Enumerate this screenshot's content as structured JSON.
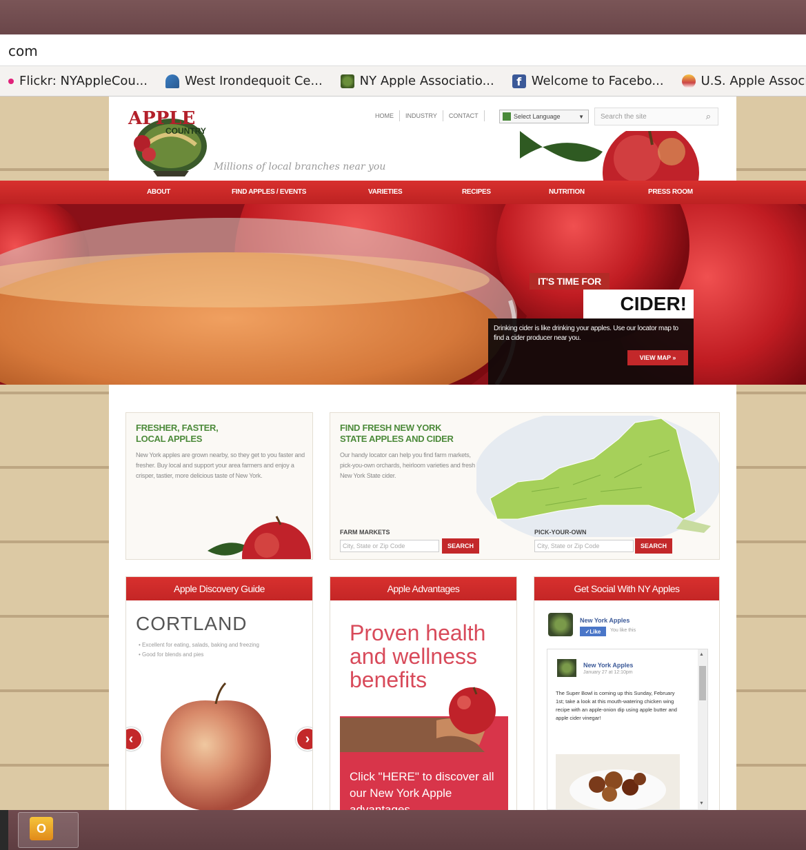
{
  "browser": {
    "url_fragment": "com",
    "bookmarks": [
      {
        "label": "Flickr: NYAppleCou...",
        "icon": "flickr-icon"
      },
      {
        "label": "West Irondequoit Ce...",
        "icon": "school-icon"
      },
      {
        "label": "NY Apple Associatio...",
        "icon": "apple-association-icon"
      },
      {
        "label": "Welcome to Facebo...",
        "icon": "facebook-icon"
      },
      {
        "label": "U.S. Apple Associati...",
        "icon": "usapple-icon"
      }
    ]
  },
  "header": {
    "logo_text": "APPLE COUNTRY",
    "tagline": "Millions of local branches near you",
    "top_nav": [
      "HOME",
      "INDUSTRY",
      "CONTACT"
    ],
    "language": "Select Language",
    "search_placeholder": "Search the site"
  },
  "main_nav": [
    "ABOUT",
    "FIND APPLES / EVENTS",
    "VARIETIES",
    "RECIPES",
    "NUTRITION",
    "PRESS ROOM"
  ],
  "hero": {
    "eyebrow": "IT'S TIME FOR",
    "headline": "CIDER!",
    "body": "Drinking cider is like drinking your apples. Use our locator map to find a cider producer near you.",
    "cta": "VIEW MAP »"
  },
  "fresher": {
    "title_line1": "FRESHER, FASTER,",
    "title_line2": "LOCAL APPLES",
    "body": "New York apples are grown nearby, so they get to you faster and fresher. Buy local and support your area farmers and enjoy a crisper, tastier, more delicious taste of New York."
  },
  "finder": {
    "title_line1": "FIND FRESH NEW YORK",
    "title_line2": "STATE APPLES AND CIDER",
    "body": "Our handy locator can help you find farm markets, pick-you-own orchards, heirloom varieties and fresh New York State cider.",
    "farm_label": "FARM MARKETS",
    "pick_label": "PICK-YOUR-OWN",
    "input_placeholder": "City, State or Zip Code",
    "search_label": "SEARCH"
  },
  "cards": {
    "discovery": {
      "title": "Apple Discovery Guide",
      "variety": "CORTLAND",
      "bullets": [
        "Excellent for eating, salads, baking and freezing",
        "Good for blends and pies"
      ]
    },
    "advantages": {
      "title": "Apple Advantages",
      "headline": "Proven health and wellness benefits",
      "cta": "Click \"HERE\" to discover all our New York Apple advantages"
    },
    "social": {
      "title": "Get Social With NY Apples",
      "page_name": "New York Apples",
      "like": "Like",
      "likes_text": "You like this",
      "post_author": "New York Apples",
      "post_time": "January 27 at 12:10pm",
      "post_text": "The Super Bowl is coming up this Sunday, February 1st; take a look at this mouth-watering chicken wing recipe with an apple-onion dip using apple butter and apple cider vinegar!"
    }
  },
  "colors": {
    "brand_red": "#c3282a",
    "brand_green": "#4c8a3a"
  }
}
